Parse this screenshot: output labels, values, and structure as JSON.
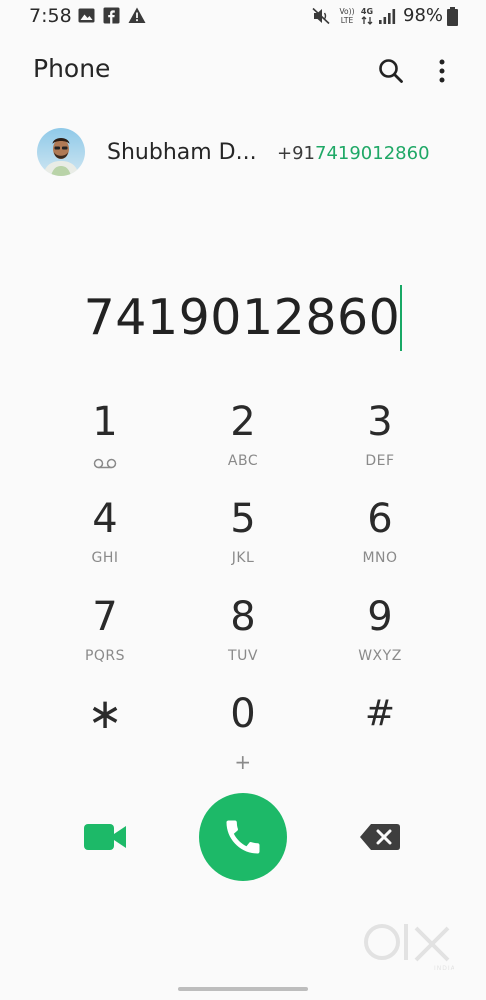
{
  "status_bar": {
    "time": "7:58",
    "battery_percent": "98%",
    "network": "4G",
    "volte_label": "Vo))\nLTE",
    "icons": [
      "gallery-icon",
      "facebook-icon",
      "alert-icon",
      "mute-icon",
      "volte-icon",
      "network-4g-icon",
      "signal-icon",
      "battery-icon"
    ]
  },
  "app_bar": {
    "title": "Phone",
    "actions": [
      "search-icon",
      "more-options-icon"
    ]
  },
  "suggested_contact": {
    "name": "Shubham D...",
    "number_prefix": "+91",
    "number_match": "7419012860"
  },
  "dialer": {
    "entered_number": "7419012860"
  },
  "keypad": {
    "keys": [
      {
        "digit": "1",
        "letters": ""
      },
      {
        "digit": "2",
        "letters": "ABC"
      },
      {
        "digit": "3",
        "letters": "DEF"
      },
      {
        "digit": "4",
        "letters": "GHI"
      },
      {
        "digit": "5",
        "letters": "JKL"
      },
      {
        "digit": "6",
        "letters": "MNO"
      },
      {
        "digit": "7",
        "letters": "PQRS"
      },
      {
        "digit": "8",
        "letters": "TUV"
      },
      {
        "digit": "9",
        "letters": "WXYZ"
      },
      {
        "digit": "∗",
        "letters": ""
      },
      {
        "digit": "0",
        "letters": "+"
      },
      {
        "digit": "#",
        "letters": ""
      }
    ]
  },
  "bottom_actions": {
    "left": "video-call-icon",
    "center": "phone-icon",
    "right": "backspace-icon"
  },
  "watermark": {
    "brand": "OLX",
    "sub": "INDIA"
  },
  "colors": {
    "accent": "#1db968",
    "match_text": "#1fa866",
    "background": "#fafafa",
    "digit": "#2a2a2a",
    "letters": "#8a8a8a"
  }
}
